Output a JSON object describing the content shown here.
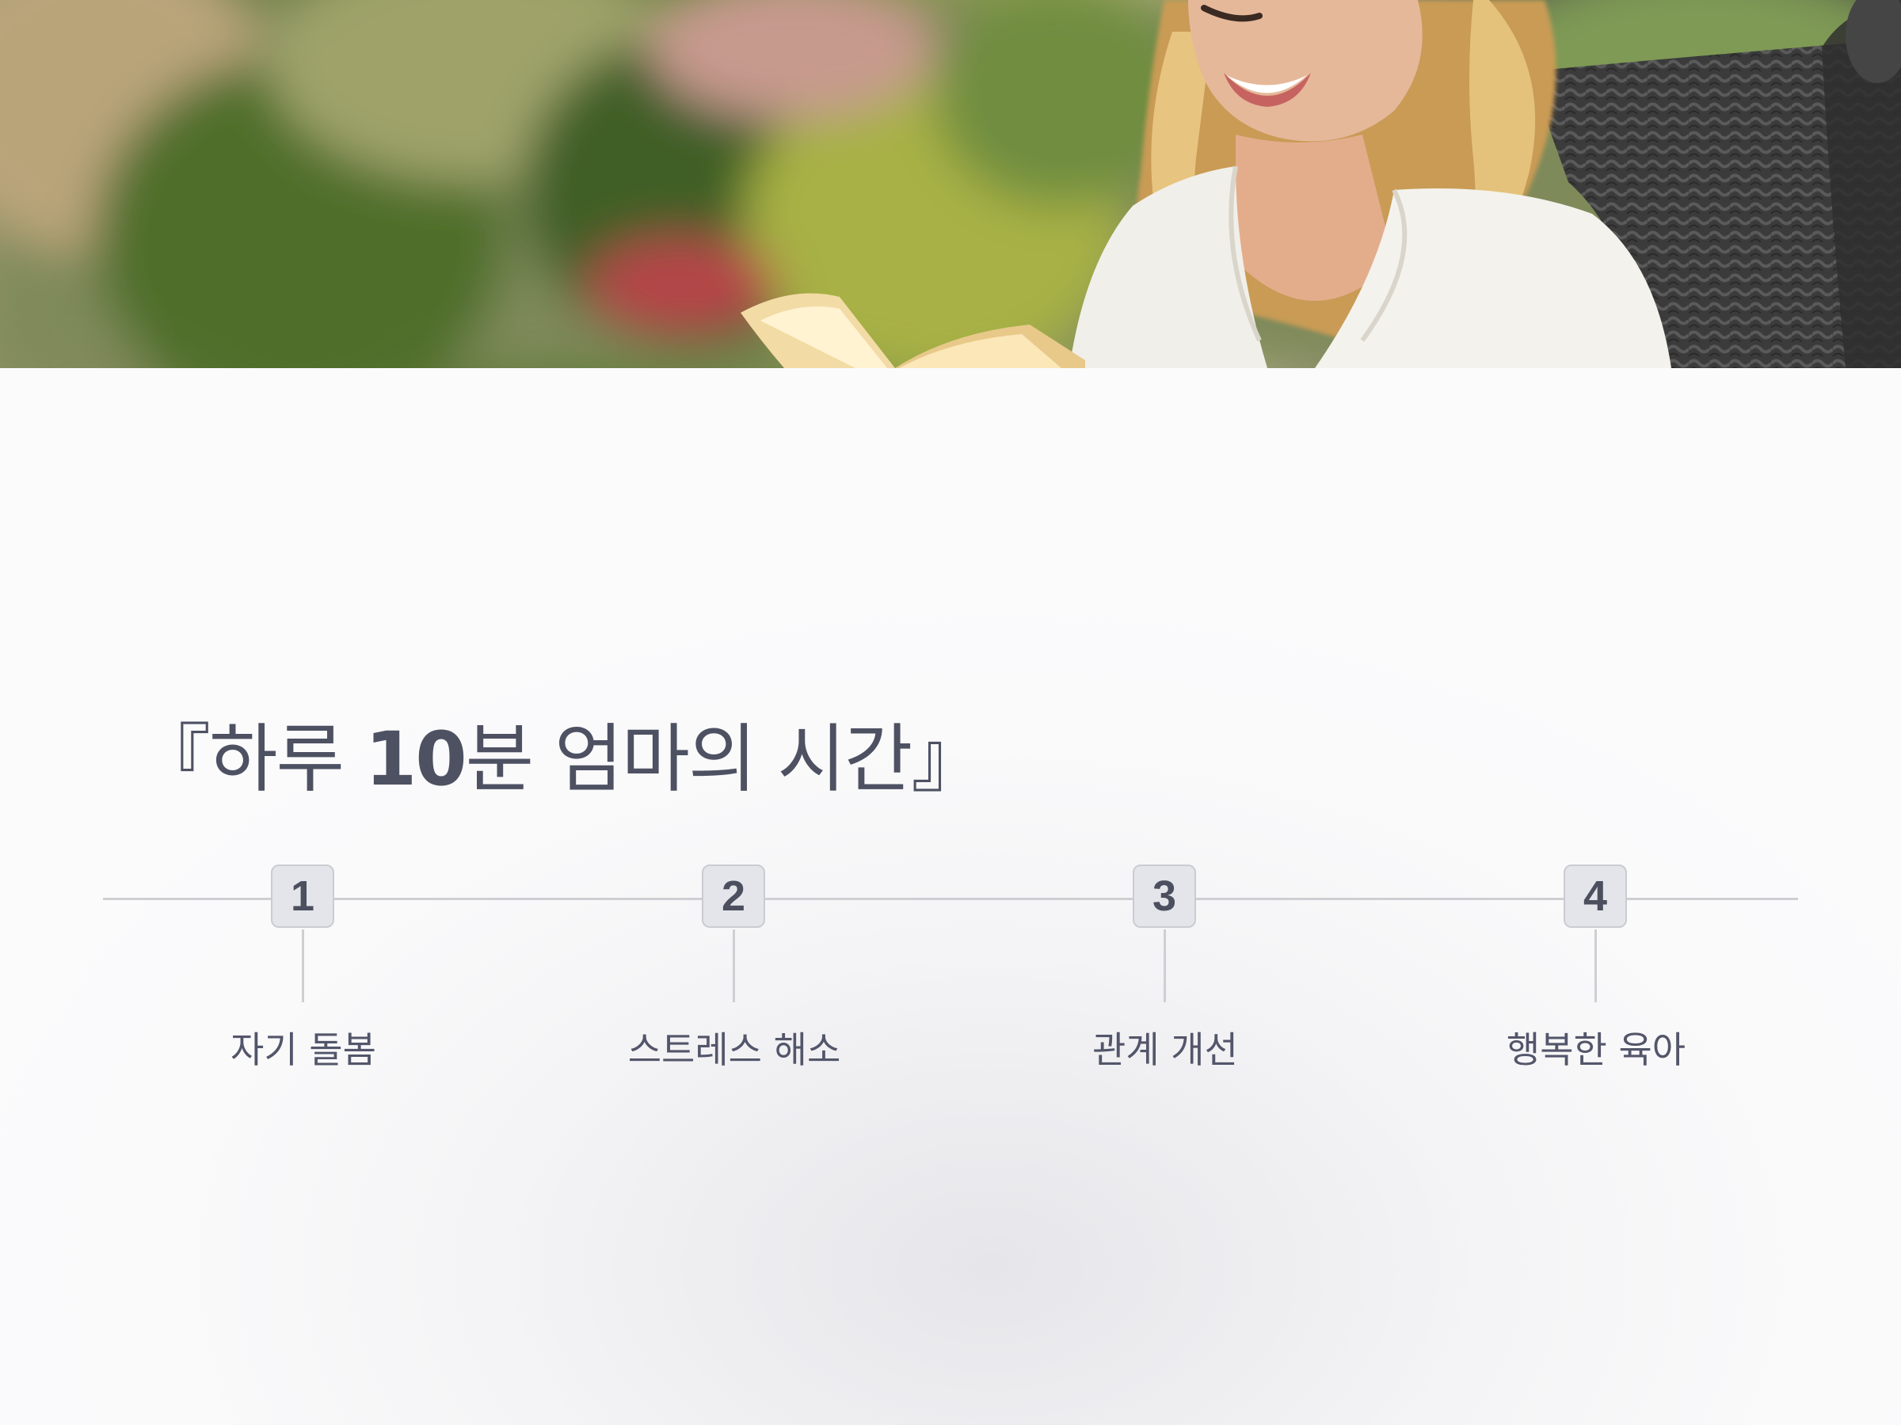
{
  "hero": {
    "image_subject": "woman-reading-book-photo"
  },
  "title": {
    "open_bracket": "『",
    "prefix": "하루 ",
    "number": "10",
    "suffix": "분 엄마의 시간",
    "close_bracket": "』"
  },
  "timeline": {
    "steps": [
      {
        "number": "1",
        "label": "자기 돌봄"
      },
      {
        "number": "2",
        "label": "스트레스 해소"
      },
      {
        "number": "3",
        "label": "관계 개선"
      },
      {
        "number": "4",
        "label": "행복한 육아"
      }
    ]
  },
  "colors": {
    "title_text": "#4d5162",
    "badge_fill": "#e4e5ea",
    "badge_border": "#cbccd2",
    "line": "#cfcfd3",
    "label_text": "#53566a"
  }
}
